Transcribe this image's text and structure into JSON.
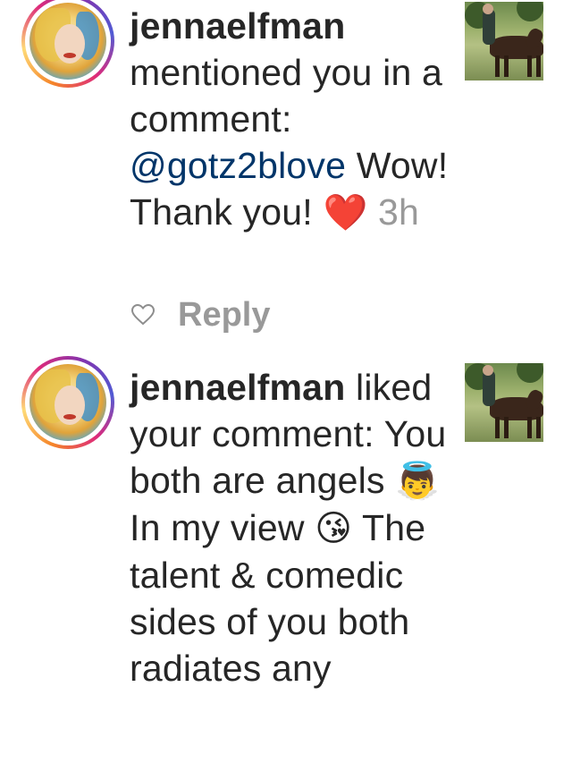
{
  "notifications": [
    {
      "username": "jennaelfman",
      "action_text": " mentioned you in a comment: ",
      "mention": "@gotz2blove",
      "comment": " Wow! Thank you! ",
      "heart": "❤️",
      "timestamp": " 3h",
      "like_icon": "heart-outline-icon",
      "reply_label": "Reply"
    },
    {
      "username": "jennaelfman",
      "action_text": " liked your comment: You both are angels ",
      "emoji_angel": "👼",
      "text_2": " In my view ",
      "emoji_kiss": "😘",
      "text_3": " The talent & comedic sides of you both radiates any"
    }
  ]
}
